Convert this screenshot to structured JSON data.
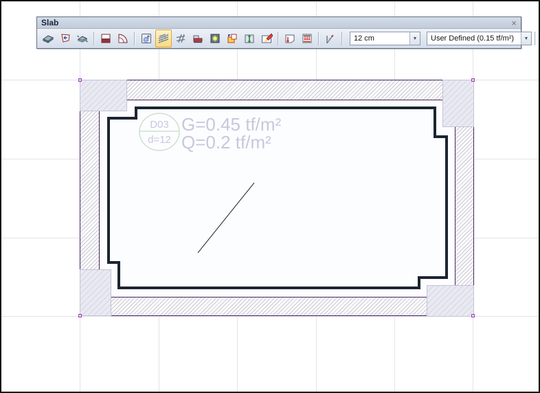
{
  "window": {
    "title": "Slab",
    "close_glyph": "×"
  },
  "toolbar": {
    "icons": [
      {
        "name": "create-slab-icon"
      },
      {
        "name": "create-slab-by-polygon-icon"
      },
      {
        "name": "match-slab-icon"
      },
      {
        "name": "drop-panel-icon"
      },
      {
        "name": "curved-edge-icon"
      },
      {
        "name": "slab-numbering-icon"
      },
      {
        "name": "hatch-display-icon",
        "active": true
      },
      {
        "name": "mesh-display-icon"
      },
      {
        "name": "slab-section-icon"
      },
      {
        "name": "column-head-icon"
      },
      {
        "name": "copy-slab-properties-icon"
      },
      {
        "name": "stretch-slab-icon"
      },
      {
        "name": "correct-slab-icon"
      },
      {
        "name": "point-load-icon"
      },
      {
        "name": "distributed-load-icon"
      },
      {
        "name": "span-direction-icon"
      },
      {
        "name": "settings-gears-icon"
      }
    ],
    "thickness_combo": {
      "value": "12 cm"
    },
    "load_combo": {
      "value": "User Defined  (0.15 tf/m²)"
    },
    "dropdown_glyph": "▼"
  },
  "drawing": {
    "slab_label": {
      "id": "D03",
      "thickness": "d=12"
    },
    "dead_load": "G=0.45 tf/m²",
    "live_load": "Q=0.2 tf/m²"
  },
  "colors": {
    "wall_border": "#4a265c",
    "slab_outline": "#1b2531",
    "annotation_text": "#c7c8dc",
    "label_circle": "#cfe0cf",
    "active_button": "#fcd97a",
    "snap_point": "#9b3fae",
    "grid": "#e3e3ec"
  }
}
